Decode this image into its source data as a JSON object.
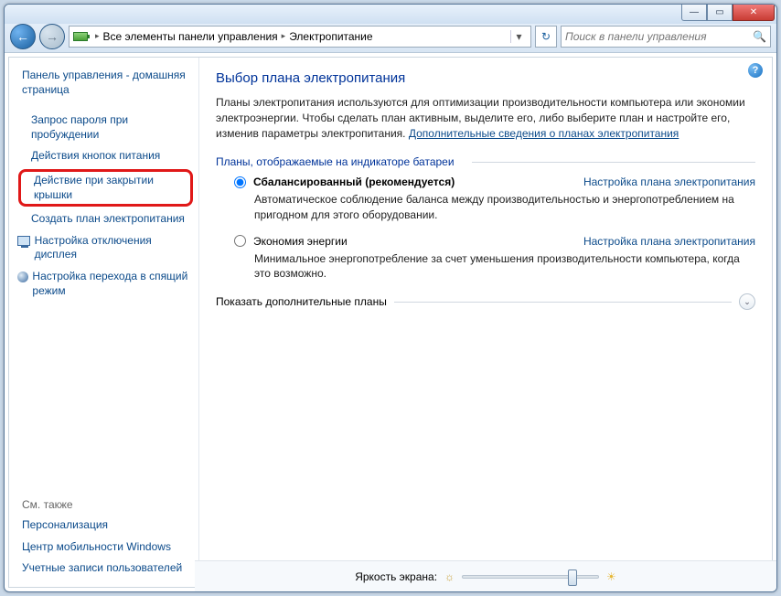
{
  "breadcrumb": {
    "level1": "Все элементы панели управления",
    "level2": "Электропитание"
  },
  "search": {
    "placeholder": "Поиск в панели управления"
  },
  "sidebar": {
    "home": "Панель управления - домашняя страница",
    "links": [
      "Запрос пароля при пробуждении",
      "Действия кнопок питания",
      "Действие при закрытии крышки",
      "Создать план электропитания",
      "Настройка отключения дисплея",
      "Настройка перехода в спящий режим"
    ],
    "seealso_title": "См. также",
    "seealso": [
      "Персонализация",
      "Центр мобильности Windows",
      "Учетные записи пользователей"
    ]
  },
  "main": {
    "title": "Выбор плана электропитания",
    "intro": "Планы электропитания используются для оптимизации производительности компьютера или экономии электроэнергии. Чтобы сделать план активным, выделите его, либо выберите план и настройте его, изменив параметры электропитания. ",
    "intro_link": "Дополнительные сведения о планах электропитания",
    "group_title": "Планы, отображаемые на индикаторе батареи",
    "plans": [
      {
        "name": "Сбалансированный (рекомендуется)",
        "selected": true,
        "link": "Настройка плана электропитания",
        "desc": "Автоматическое соблюдение баланса между производительностью и энергопотреблением на пригодном для этого оборудовании."
      },
      {
        "name": "Экономия энергии",
        "selected": false,
        "link": "Настройка плана электропитания",
        "desc": "Минимальное энергопотребление за счет уменьшения производительности компьютера, когда это возможно."
      }
    ],
    "expand": "Показать дополнительные планы",
    "brightness_label": "Яркость экрана:"
  }
}
